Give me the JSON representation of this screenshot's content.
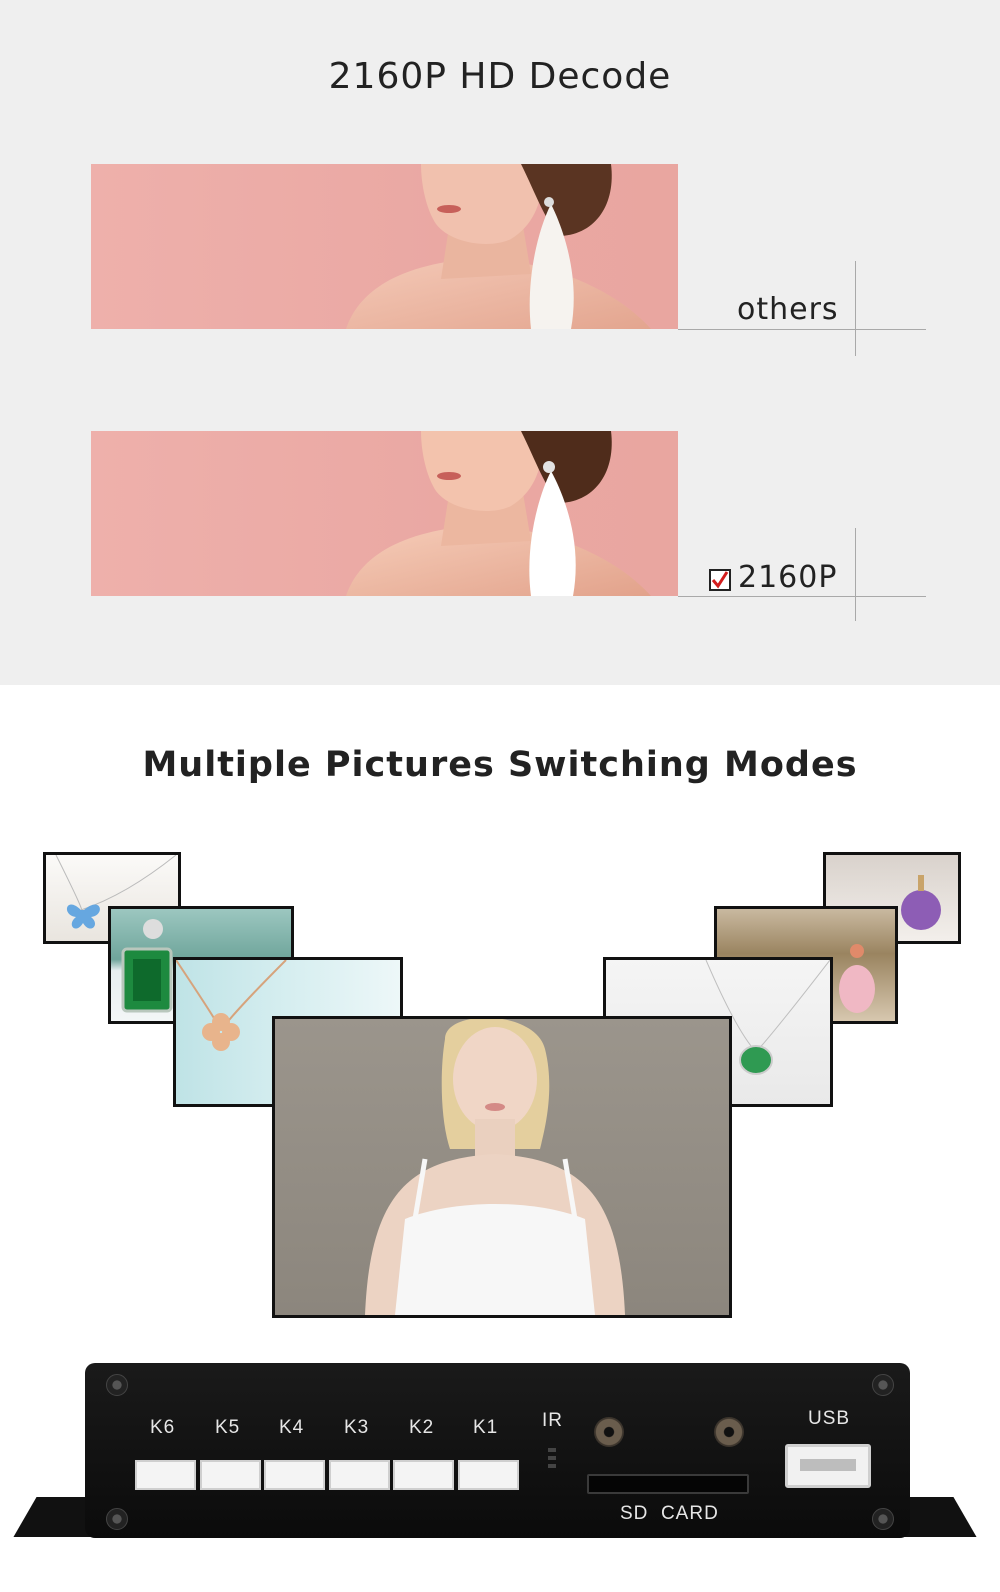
{
  "section1": {
    "title": "2160P HD Decode",
    "label_top": "others",
    "label_bottom": "2160P",
    "checkbox_checked": true
  },
  "section2": {
    "title": "Multiple Pictures Switching Modes"
  },
  "device": {
    "connectors": [
      "K6",
      "K5",
      "K4",
      "K3",
      "K2",
      "K1"
    ],
    "ir_label": "IR",
    "usb_label": "USB",
    "sd_label": "SD  CARD"
  },
  "colors": {
    "banner_pink": "#eaa8a3",
    "check_red": "#d21c1c",
    "top_background": "#efefef"
  }
}
